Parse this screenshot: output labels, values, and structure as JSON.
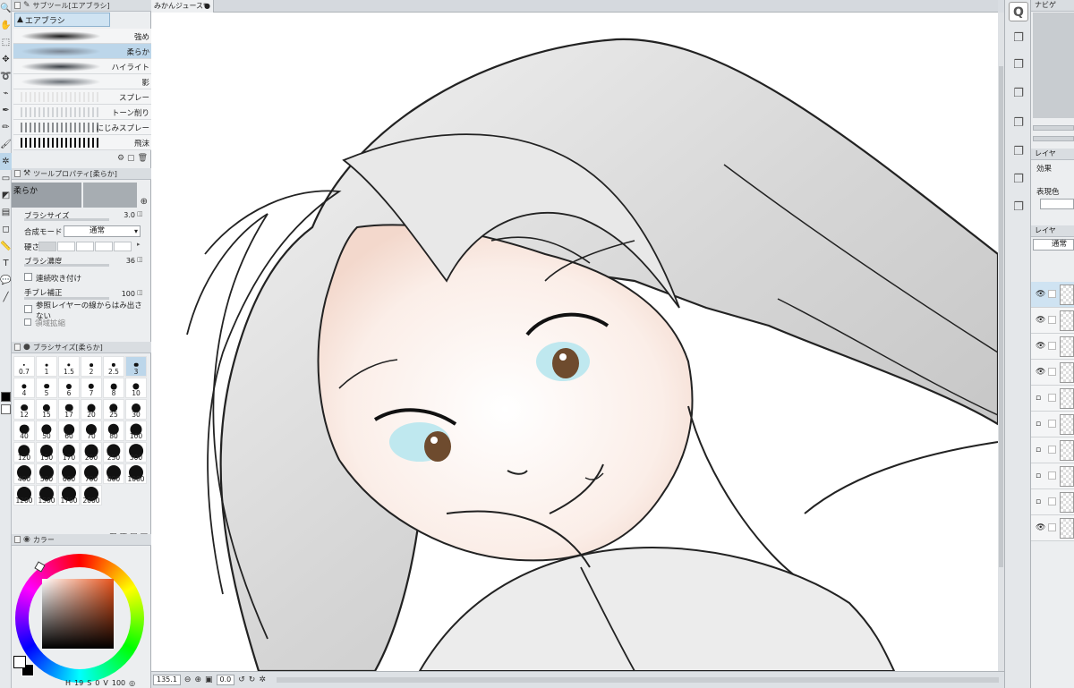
{
  "toolbar": {
    "tools": [
      "zoom-icon",
      "hand-icon",
      "selection-icon",
      "move-icon",
      "lasso-icon",
      "eyedropper-icon",
      "pen-icon",
      "pencil-icon",
      "brush-icon",
      "airbrush-icon",
      "eraser-icon",
      "fill-icon",
      "gradient-icon",
      "shape-icon",
      "ruler-icon",
      "text-icon",
      "balloon-icon",
      "line-icon"
    ],
    "fg_color": "#000000",
    "bg_color": "#ffffff"
  },
  "subtool": {
    "title": "サブツール[エアブラシ]",
    "group": "エアブラシ",
    "brushes": [
      {
        "label": "強め",
        "selected": false
      },
      {
        "label": "柔らか",
        "selected": true
      },
      {
        "label": "ハイライト",
        "selected": false
      },
      {
        "label": "影",
        "selected": false
      },
      {
        "label": "スプレー",
        "selected": false
      },
      {
        "label": "トーン削り",
        "selected": false
      },
      {
        "label": "にじみスプレー",
        "selected": false
      },
      {
        "label": "飛沫",
        "selected": false
      }
    ]
  },
  "toolprop": {
    "title": "ツールプロパティ[柔らか]",
    "name": "柔らか",
    "brush_size_label": "ブラシサイズ",
    "brush_size_value": "3.0",
    "blend_label": "合成モード",
    "blend_value": "通常",
    "hardness_label": "硬さ",
    "density_label": "ブラシ濃度",
    "density_value": "36",
    "continuous_label": "連続吹き付け",
    "stabilizer_label": "手ブレ補正",
    "stabilizer_value": "100",
    "reference_label": "参照レイヤーの線からはみ出さない",
    "extra_label": "領域拡縮"
  },
  "brushsize": {
    "title": "ブラシサイズ[柔らか]",
    "sizes": [
      "0.7",
      "1",
      "1.5",
      "2",
      "2.5",
      "3",
      "4",
      "5",
      "6",
      "7",
      "8",
      "10",
      "12",
      "15",
      "17",
      "20",
      "25",
      "30",
      "40",
      "50",
      "60",
      "70",
      "80",
      "100",
      "120",
      "150",
      "170",
      "200",
      "250",
      "300",
      "400",
      "500",
      "600",
      "700",
      "800",
      "1000",
      "1200",
      "1500",
      "1700",
      "2000"
    ],
    "selected": "3"
  },
  "colorpanel": {
    "title": "カラー",
    "hue_color": "#e8541c",
    "status_a": "19",
    "status_b": "0",
    "status_c": "100"
  },
  "canvas": {
    "tab_title": "みかんジュース*",
    "zoom": "135.1",
    "angle": "0.0"
  },
  "right": {
    "navigator_title": "ナビゲ",
    "layerprop_title": "レイヤ",
    "effect_label": "効果",
    "expression_color_label": "表現色",
    "layer_title": "レイヤ",
    "blend_value": "通常",
    "layers": [
      {
        "visible": true,
        "selected": true
      },
      {
        "visible": true,
        "selected": false
      },
      {
        "visible": true,
        "selected": false
      },
      {
        "visible": true,
        "selected": false
      },
      {
        "visible": false,
        "selected": false
      },
      {
        "visible": false,
        "selected": false
      },
      {
        "visible": false,
        "selected": false
      },
      {
        "visible": false,
        "selected": false
      },
      {
        "visible": false,
        "selected": false
      },
      {
        "visible": true,
        "selected": false
      }
    ]
  }
}
